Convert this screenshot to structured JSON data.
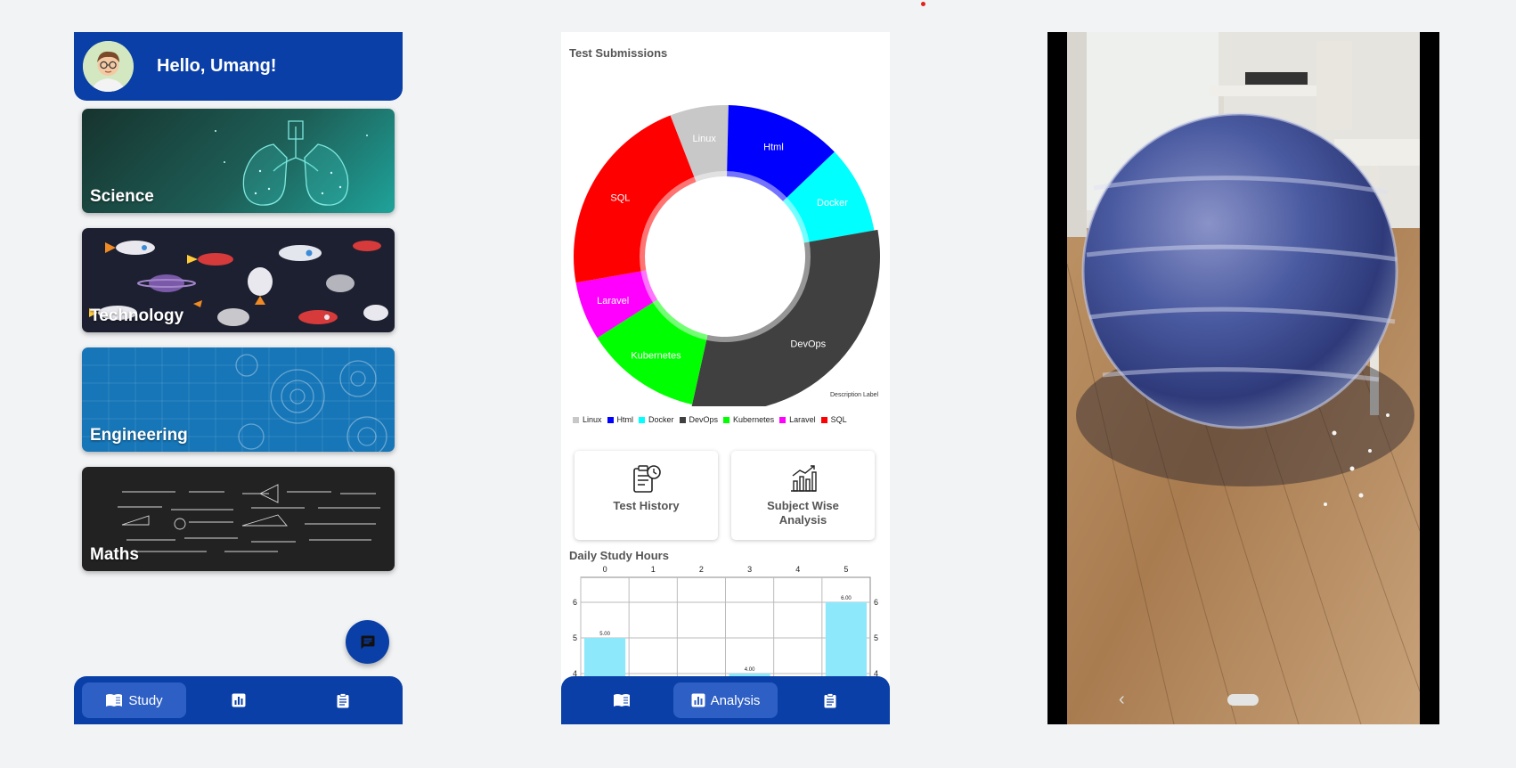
{
  "study": {
    "greeting": "Hello, Umang!",
    "subjects": [
      {
        "label": "Science"
      },
      {
        "label": "Technology"
      },
      {
        "label": "Engineering"
      },
      {
        "label": "Maths"
      }
    ],
    "chat_icon": "chat-icon",
    "nav": [
      {
        "label": "Study",
        "icon": "book-icon",
        "active": true
      },
      {
        "label": "",
        "icon": "analytics-icon",
        "active": false
      },
      {
        "label": "",
        "icon": "clipboard-icon",
        "active": false
      }
    ]
  },
  "analysis": {
    "test_submissions_title": "Test Submissions",
    "description_label": "Description Label",
    "tiles": [
      {
        "label": "Test History",
        "icon": "history-icon"
      },
      {
        "label": "Subject Wise Analysis",
        "icon": "bar-chart-icon"
      }
    ],
    "daily_study_title": "Daily Study Hours",
    "nav": [
      {
        "label": "",
        "icon": "book-icon",
        "active": false
      },
      {
        "label": "Analysis",
        "icon": "analytics-icon",
        "active": true
      },
      {
        "label": "",
        "icon": "clipboard-icon",
        "active": false
      }
    ]
  },
  "chart_data": [
    {
      "type": "pie",
      "title": "Test Submissions",
      "categories": [
        "Linux",
        "Html",
        "Docker",
        "DevOps",
        "Kubernetes",
        "Laravel",
        "SQL"
      ],
      "values": [
        10,
        20,
        15,
        50,
        20,
        10,
        35
      ],
      "colors": [
        "#c8c8c8",
        "#0000ff",
        "#00ffff",
        "#404040",
        "#00ff00",
        "#ff00ff",
        "#ff0000"
      ],
      "legend": "bottom",
      "donut": true
    },
    {
      "type": "bar",
      "title": "Daily Study Hours",
      "x": [
        0,
        1,
        2,
        3,
        4,
        5
      ],
      "values": [
        5.0,
        0,
        0,
        4.0,
        0,
        6.0
      ],
      "value_labels": [
        "5.00",
        "",
        "",
        "4.00",
        "",
        "6.00"
      ],
      "y_ticks_visible": [
        6,
        5,
        4
      ],
      "color": "#8de8fb",
      "grid": true
    }
  ],
  "ar": {
    "back_icon": "back-chevron-icon",
    "home_icon": "home-pill-icon"
  }
}
